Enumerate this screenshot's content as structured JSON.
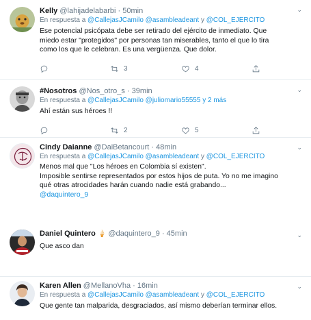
{
  "tweets": [
    {
      "name": "Kelly",
      "handle": "@lahijadelabarbi",
      "time": "50min",
      "reply_prefix": "En respuesta a",
      "reply_mentions": [
        "@CallejasJCamilo",
        "@asambleadeant"
      ],
      "reply_joiner": "y",
      "reply_last": "@COL_EJERCITO",
      "lines": [
        "Ese potencial psicópata debe ser retirado del ejército de inmediato. Que",
        "miedo estar \"protegidos\" por personas tan miserables, tanto el que lo tira",
        "como los que le celebran. Es una vergüenza. Que dolor."
      ],
      "retweets": "3",
      "likes": "4"
    },
    {
      "name": "#Nosotros",
      "handle": "@Nos_otro_s",
      "time": "39min",
      "reply_prefix": "En respuesta a",
      "reply_mentions": [
        "@CallejasJCamilo",
        "@juliomario55555"
      ],
      "reply_joiner": "y",
      "reply_last": "2 más",
      "lines": [
        "Ahí están sus héroes !!"
      ],
      "retweets": "2",
      "likes": "5"
    },
    {
      "name": "Cindy Daianne",
      "handle": "@DaiBetancourt",
      "time": "48min",
      "reply_prefix": "En respuesta a",
      "reply_mentions": [
        "@CallejasJCamilo",
        "@asambleadeant"
      ],
      "reply_joiner": "y",
      "reply_last": "@COL_EJERCITO",
      "lines": [
        "Menos mal que \"Los héroes en Colombia sí existen\".",
        "Imposible sentirse representados por estos hijos de puta. Yo no me imagino",
        "qué otras atrocidades harán cuando nadie está grabando..."
      ],
      "link": "@daquintero_9"
    },
    {
      "name": "Daniel Quintero",
      "emoji": "🍦",
      "handle": "@daquintero_9",
      "time": "45min",
      "lines": [
        "Que asco dan"
      ]
    },
    {
      "name": "Karen Allen",
      "handle": "@MellanoVha",
      "time": "16min",
      "reply_prefix": "En respuesta a",
      "reply_mentions": [
        "@CallejasJCamilo",
        "@asambleadeant"
      ],
      "reply_joiner": "y",
      "reply_last": "@COL_EJERCITO",
      "lines": [
        "Que gente tan malparida, desgraciados, así mismo deberían terminar ellos."
      ]
    }
  ],
  "dot": "·",
  "icons": [
    "reply-icon",
    "retweet-icon",
    "like-icon",
    "share-icon",
    "caret-icon"
  ]
}
